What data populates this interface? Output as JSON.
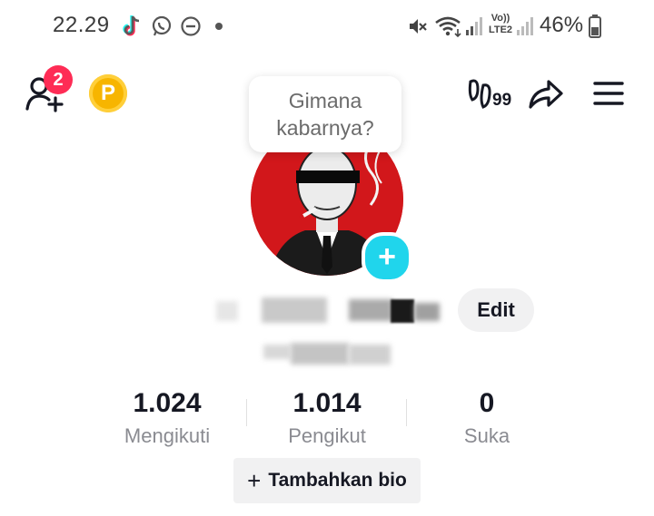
{
  "status_bar": {
    "time": "22.29",
    "battery_percent": "46%",
    "network_label_top": "Vo))",
    "network_label_bottom": "LTE2"
  },
  "header": {
    "friend_requests_badge": "2",
    "coin_letter": "P",
    "views_count": "99",
    "icons": [
      "add-friend-icon",
      "coin-icon",
      "profile-views-icon",
      "share-icon",
      "menu-icon"
    ]
  },
  "profile": {
    "note_bubble": "Gimana kabarnya?",
    "edit_label": "Edit",
    "add_avatar_symbol": "+"
  },
  "stats": [
    {
      "value": "1.024",
      "label": "Mengikuti"
    },
    {
      "value": "1.014",
      "label": "Pengikut"
    },
    {
      "value": "0",
      "label": "Suka"
    }
  ],
  "bio": {
    "add_bio_label": "Tambahkan bio",
    "add_symbol": "+"
  },
  "colors": {
    "accent_pink": "#fe2c55",
    "accent_cyan": "#20d5ec",
    "coin_gold": "#f7b500"
  }
}
